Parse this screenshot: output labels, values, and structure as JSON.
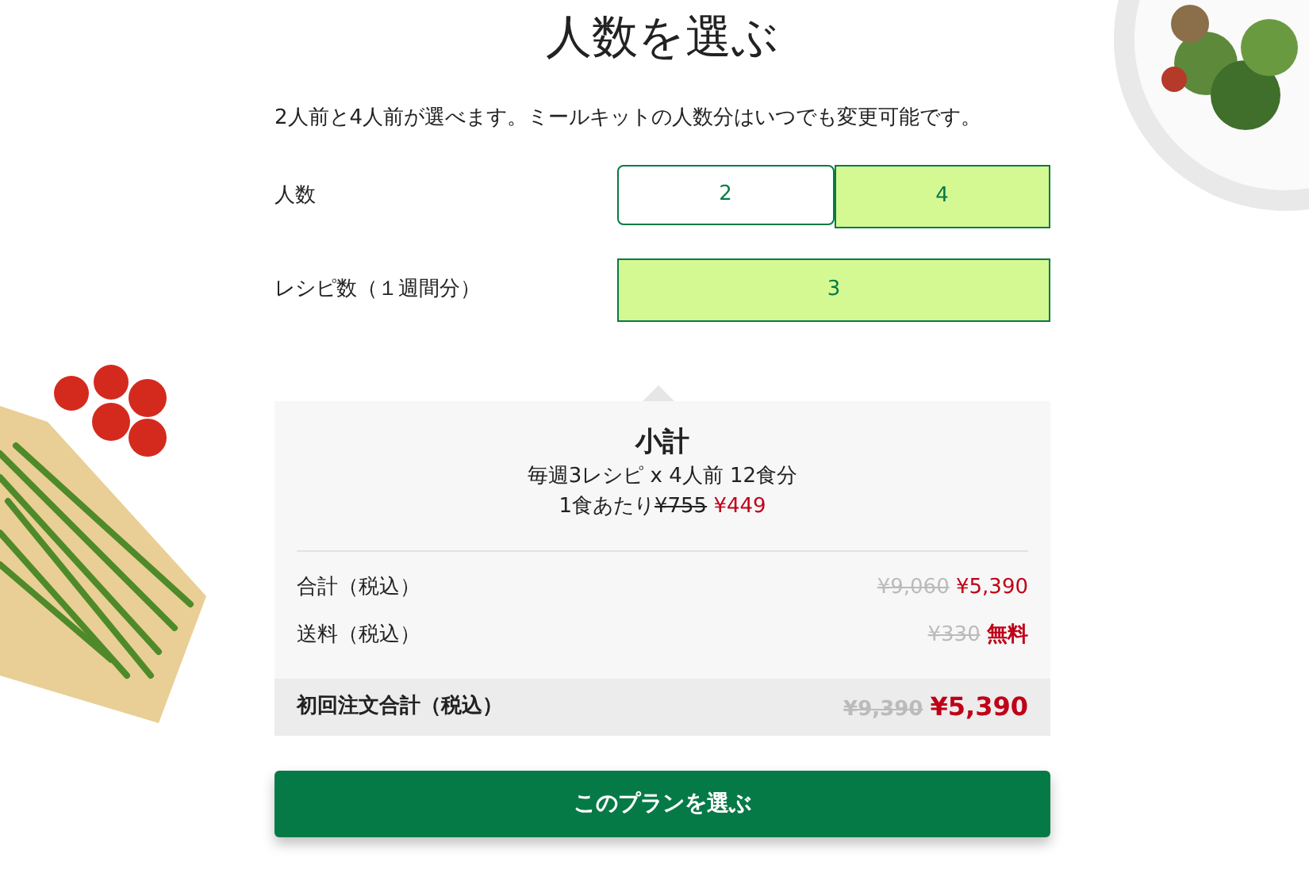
{
  "title": "人数を選ぶ",
  "description": "2人前と4人前が選べます。ミールキットの人数分はいつでも変更可能です。",
  "options": [
    {
      "label": "人数",
      "choices": [
        {
          "label": "2",
          "selected": false
        },
        {
          "label": "4",
          "selected": true
        }
      ]
    },
    {
      "label": "レシピ数（１週間分）",
      "choices": [
        {
          "label": "3",
          "selected": true
        }
      ]
    }
  ],
  "summary": {
    "title": "小計",
    "plan": "毎週3レシピ x 4人前 12食分",
    "per_meal_label": "1食あたり",
    "per_meal_old": "¥755",
    "per_meal_new": "¥449",
    "rows": [
      {
        "label": "合計（税込）",
        "old": "¥9,060",
        "new": "¥5,390"
      },
      {
        "label": "送料（税込）",
        "old": "¥330",
        "new": "無料"
      }
    ],
    "total": {
      "label": "初回注文合計（税込）",
      "old": "¥9,390",
      "new": "¥5,390"
    }
  },
  "button": "このプランを選ぶ"
}
